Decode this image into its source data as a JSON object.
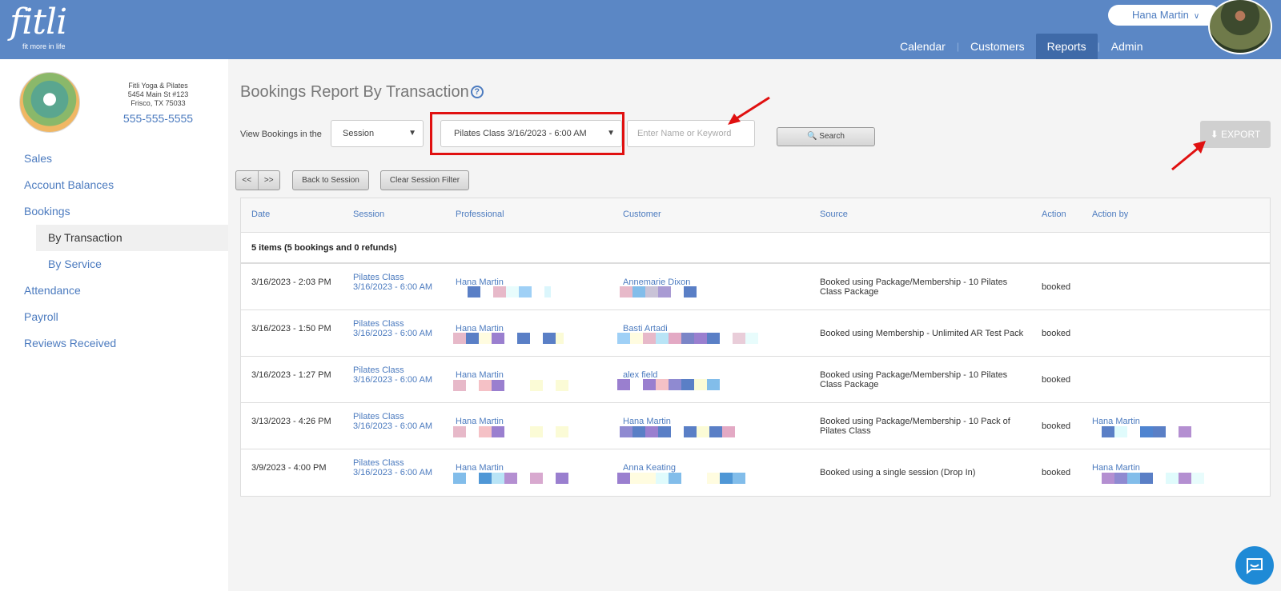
{
  "header": {
    "logo": {
      "word": "fitli",
      "tagline": "fit more in life"
    },
    "user_name": "Hana Martin",
    "nav": [
      {
        "label": "Calendar",
        "active": false
      },
      {
        "label": "Customers",
        "active": false
      },
      {
        "label": "Reports",
        "active": true
      },
      {
        "label": "Admin",
        "active": false
      }
    ]
  },
  "studio": {
    "name": "Fitli Yoga & Pilates",
    "address1": "5454 Main St #123",
    "address2": "Frisco, TX 75033",
    "phone": "555-555-5555"
  },
  "sidebar": {
    "items": [
      {
        "label": "Sales"
      },
      {
        "label": "Account Balances"
      },
      {
        "label": "Bookings"
      },
      {
        "label": "By Transaction",
        "active": true
      },
      {
        "label": "By Service"
      },
      {
        "label": "Attendance"
      },
      {
        "label": "Payroll"
      },
      {
        "label": "Reviews Received"
      }
    ]
  },
  "main": {
    "title": "Bookings Report By Transaction",
    "help_icon": "?",
    "filter_label": "View Bookings in the",
    "period_select": "Session",
    "session_select": "Pilates Class 3/16/2023 - 6:00 AM",
    "keyword_placeholder": "Enter Name or Keyword",
    "search_label": "Search",
    "export_label": "EXPORT",
    "prev_label": "<<",
    "next_label": ">>",
    "back_label": "Back to Session",
    "clear_label": "Clear Session Filter"
  },
  "table": {
    "headers": [
      "Date",
      "Session",
      "Professional",
      "Customer",
      "Source",
      "Action",
      "Action by"
    ],
    "count_text": "5 items (5 bookings and 0 refunds)",
    "rows": [
      {
        "date": "3/16/2023 - 2:03 PM",
        "session": "Pilates Class 3/16/2023 - 6:00 AM",
        "professional": "Hana Martin",
        "customer": "Annemarie Dixon",
        "source": "Booked using Package/Membership - 10 Pilates Class Package",
        "action": "booked",
        "action_by": ""
      },
      {
        "date": "3/16/2023 - 1:50 PM",
        "session": "Pilates Class 3/16/2023 - 6:00 AM",
        "professional": "Hana Martin",
        "customer": "Basti Artadi",
        "source": "Booked using Membership - Unlimited AR Test Pack",
        "action": "booked",
        "action_by": ""
      },
      {
        "date": "3/16/2023 - 1:27 PM",
        "session": "Pilates Class 3/16/2023 - 6:00 AM",
        "professional": "Hana Martin",
        "customer": "alex field",
        "source": "Booked using Package/Membership - 10 Pilates Class Package",
        "action": "booked",
        "action_by": ""
      },
      {
        "date": "3/13/2023 - 4:26 PM",
        "session": "Pilates Class 3/16/2023 - 6:00 AM",
        "professional": "Hana Martin",
        "customer": "Hana Martin",
        "source": "Booked using Package/Membership - 10 Pack of Pilates Class",
        "action": "booked",
        "action_by": "Hana Martin"
      },
      {
        "date": "3/9/2023 - 4:00 PM",
        "session": "Pilates Class 3/16/2023 - 6:00 AM",
        "professional": "Hana Martin",
        "customer": "Anna Keating",
        "source": "Booked using a single session (Drop In)",
        "action": "booked",
        "action_by": "Hana Martin"
      }
    ]
  },
  "colors": {
    "header": "#5b87c5",
    "link": "#4c7bbf",
    "highlight": "#e01010"
  }
}
